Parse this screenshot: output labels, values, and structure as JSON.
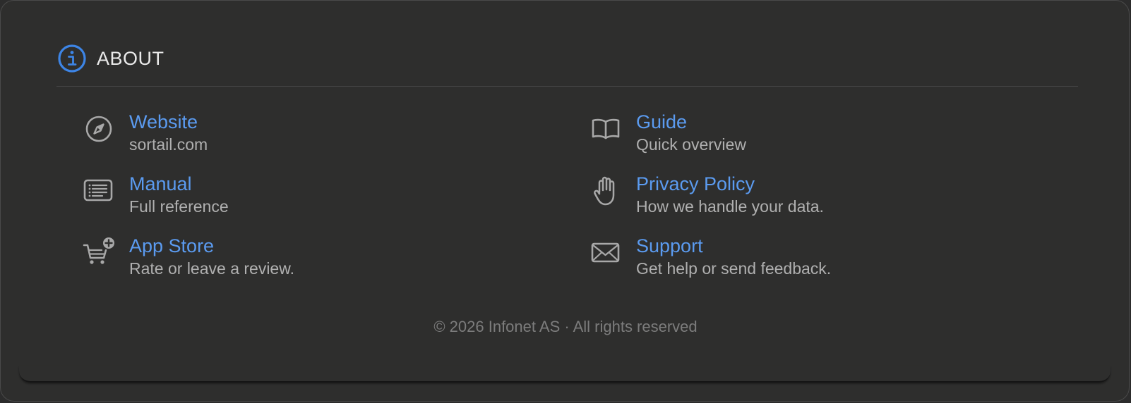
{
  "header": {
    "title": "ABOUT",
    "icon": "info-circle-icon",
    "accent": "#3d85e6"
  },
  "items": [
    {
      "title": "Website",
      "subtitle": "sortail.com",
      "icon": "compass-icon"
    },
    {
      "title": "Guide",
      "subtitle": "Quick overview",
      "icon": "book-icon"
    },
    {
      "title": "Manual",
      "subtitle": "Full reference",
      "icon": "document-list-icon"
    },
    {
      "title": "Privacy Policy",
      "subtitle": "How we handle your data.",
      "icon": "hand-icon"
    },
    {
      "title": "App Store",
      "subtitle": "Rate or leave a review.",
      "icon": "cart-plus-icon"
    },
    {
      "title": "Support",
      "subtitle": "Get help or send feedback.",
      "icon": "envelope-icon"
    }
  ],
  "footer": {
    "text": "© 2026 Infonet AS · All rights reserved"
  },
  "colors": {
    "link": "#5b9bf0",
    "subtitle": "#b0b0b0",
    "icon": "#a8a8a8",
    "background": "#2e2e2d"
  }
}
